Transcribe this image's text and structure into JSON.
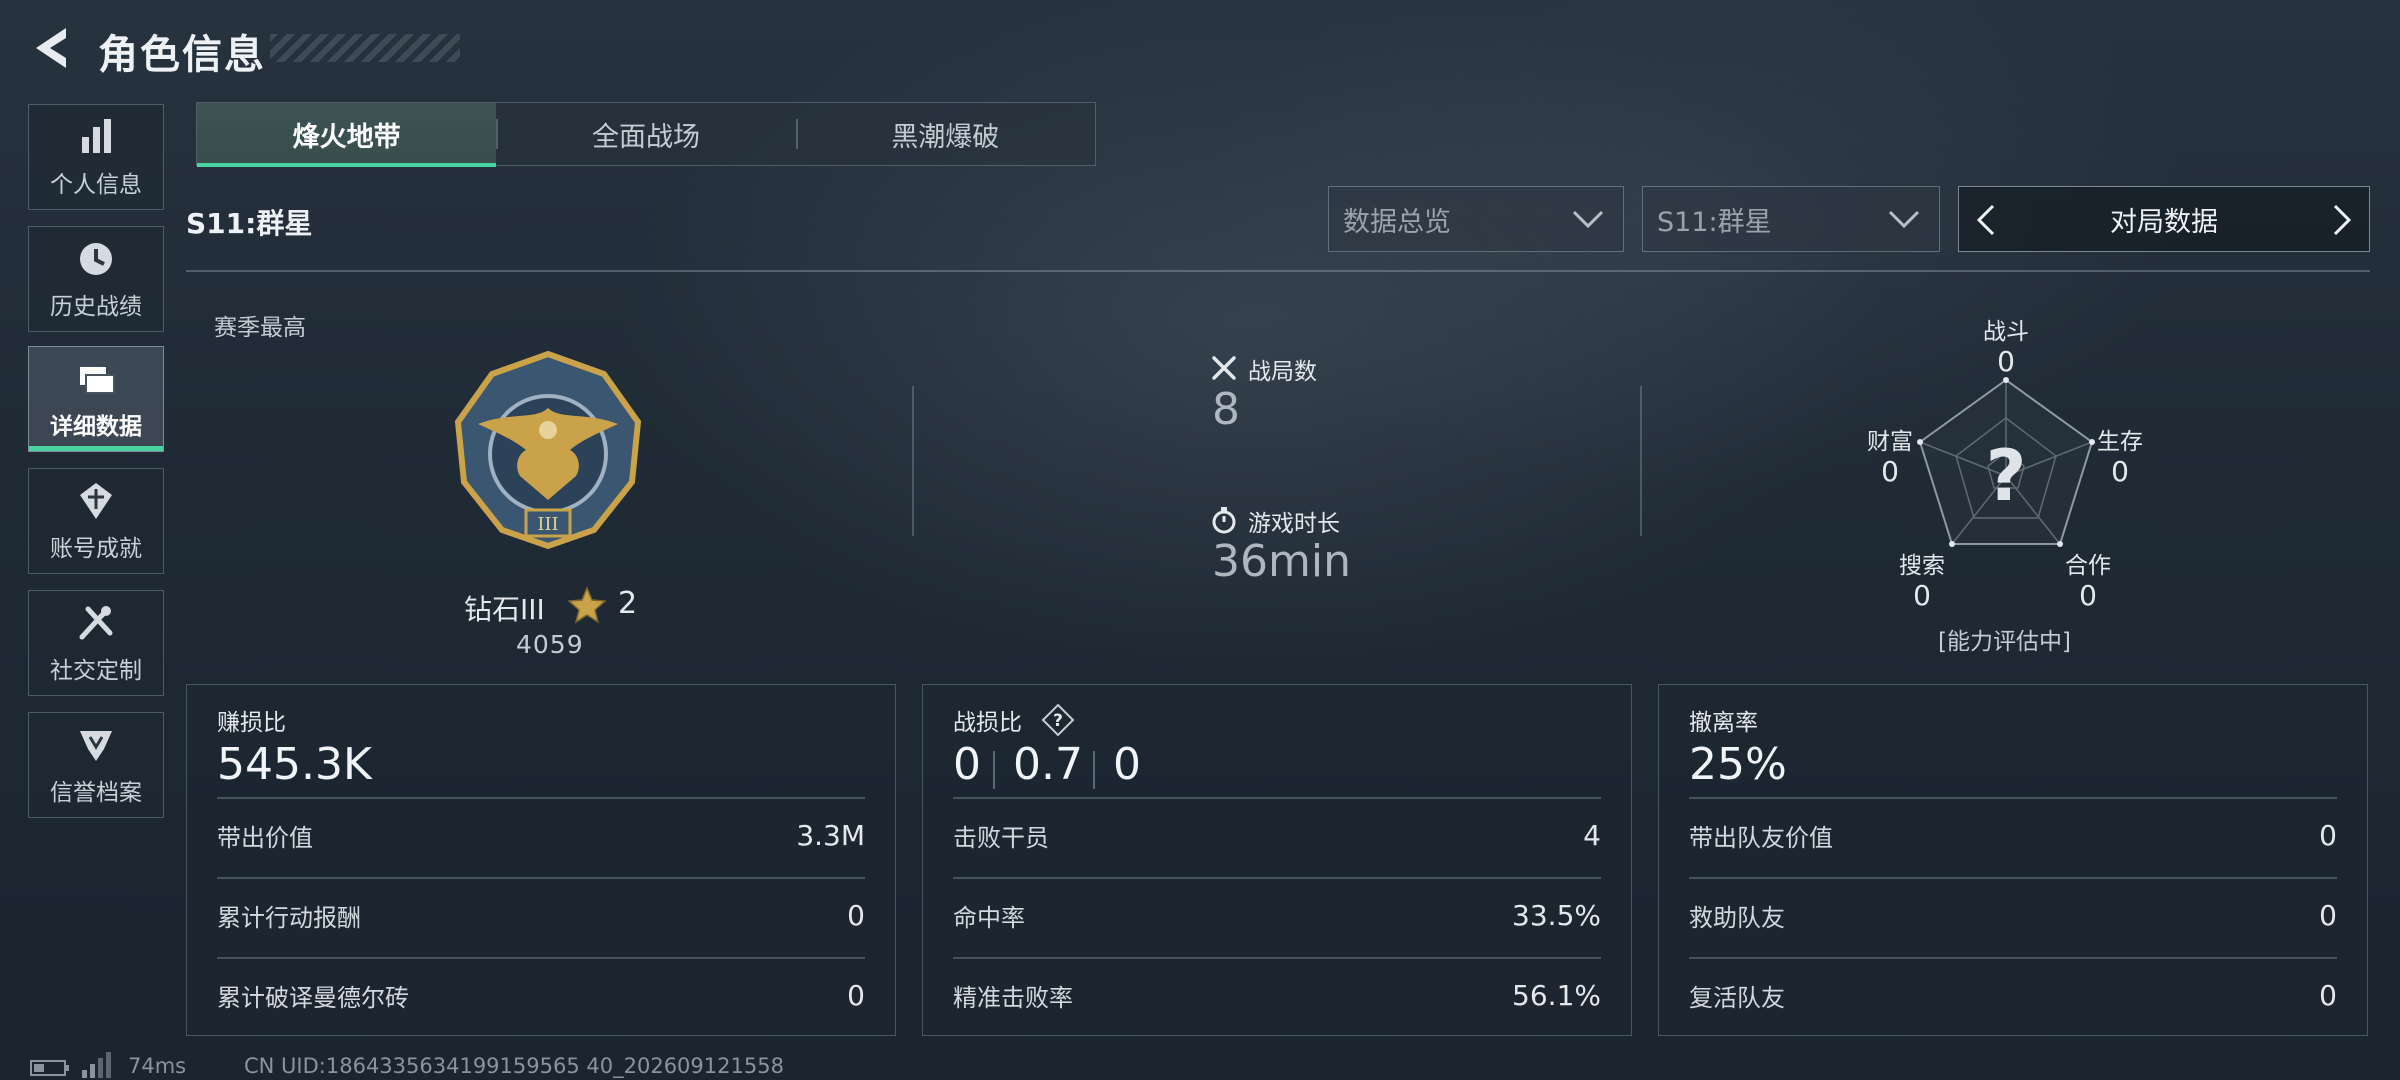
{
  "header": {
    "title": "角色信息",
    "back_icon": "chevron-left-icon"
  },
  "sidebar": {
    "items": [
      {
        "label": "个人信息",
        "icon": "bar-chart-icon",
        "active": false
      },
      {
        "label": "历史战绩",
        "icon": "history-clock-icon",
        "active": false
      },
      {
        "label": "详细数据",
        "icon": "folders-icon",
        "active": true
      },
      {
        "label": "账号成就",
        "icon": "achievement-icon",
        "active": false
      },
      {
        "label": "社交定制",
        "icon": "tools-icon",
        "active": false
      },
      {
        "label": "信誉档案",
        "icon": "shield-badge-icon",
        "active": false
      }
    ]
  },
  "tabs": [
    {
      "label": "烽火地带",
      "active": true
    },
    {
      "label": "全面战场",
      "active": false
    },
    {
      "label": "黑潮爆破",
      "active": false
    }
  ],
  "filters": {
    "season_label": "S11:群星",
    "overview_select": "数据总览",
    "season_select": "S11:群星",
    "switcher_label": "对局数据"
  },
  "rank": {
    "caption": "赛季最高",
    "name": "钻石III",
    "stars": "2",
    "points": "4059",
    "emblem_numeral": "III"
  },
  "matches": {
    "count_label": "战局数",
    "count_value": "8",
    "time_label": "游戏时长",
    "time_value": "36min"
  },
  "radar": {
    "labels": {
      "combat": "战斗",
      "survival": "生存",
      "cooperation": "合作",
      "search": "搜索",
      "wealth": "财富"
    },
    "values": {
      "combat": "0",
      "survival": "0",
      "cooperation": "0",
      "search": "0",
      "wealth": "0"
    },
    "center_mark": "?",
    "status": "[能力评估中]"
  },
  "cards": {
    "profit": {
      "title": "赚损比",
      "value": "545.3K",
      "rows": [
        {
          "label": "带出价值",
          "value": "3.3M"
        },
        {
          "label": "累计行动报酬",
          "value": "0"
        },
        {
          "label": "累计破译曼德尔砖",
          "value": "0"
        }
      ]
    },
    "combat": {
      "title": "战损比",
      "help": "?",
      "kd_left": "0",
      "kd_mid": "0.7",
      "kd_right": "0",
      "rows": [
        {
          "label": "击败干员",
          "value": "4"
        },
        {
          "label": "命中率",
          "value": "33.5%"
        },
        {
          "label": "精准击败率",
          "value": "56.1%"
        }
      ]
    },
    "extract": {
      "title": "撤离率",
      "value": "25%",
      "rows": [
        {
          "label": "带出队友价值",
          "value": "0"
        },
        {
          "label": "救助队友",
          "value": "0"
        },
        {
          "label": "复活队友",
          "value": "0"
        }
      ]
    }
  },
  "footer": {
    "ping": "74ms",
    "uid": "CN UID:1864335634199159565 40_202609121558"
  },
  "colors": {
    "accent": "#47d4a0",
    "background": "#1f2a35",
    "gold": "#c9a24a"
  }
}
